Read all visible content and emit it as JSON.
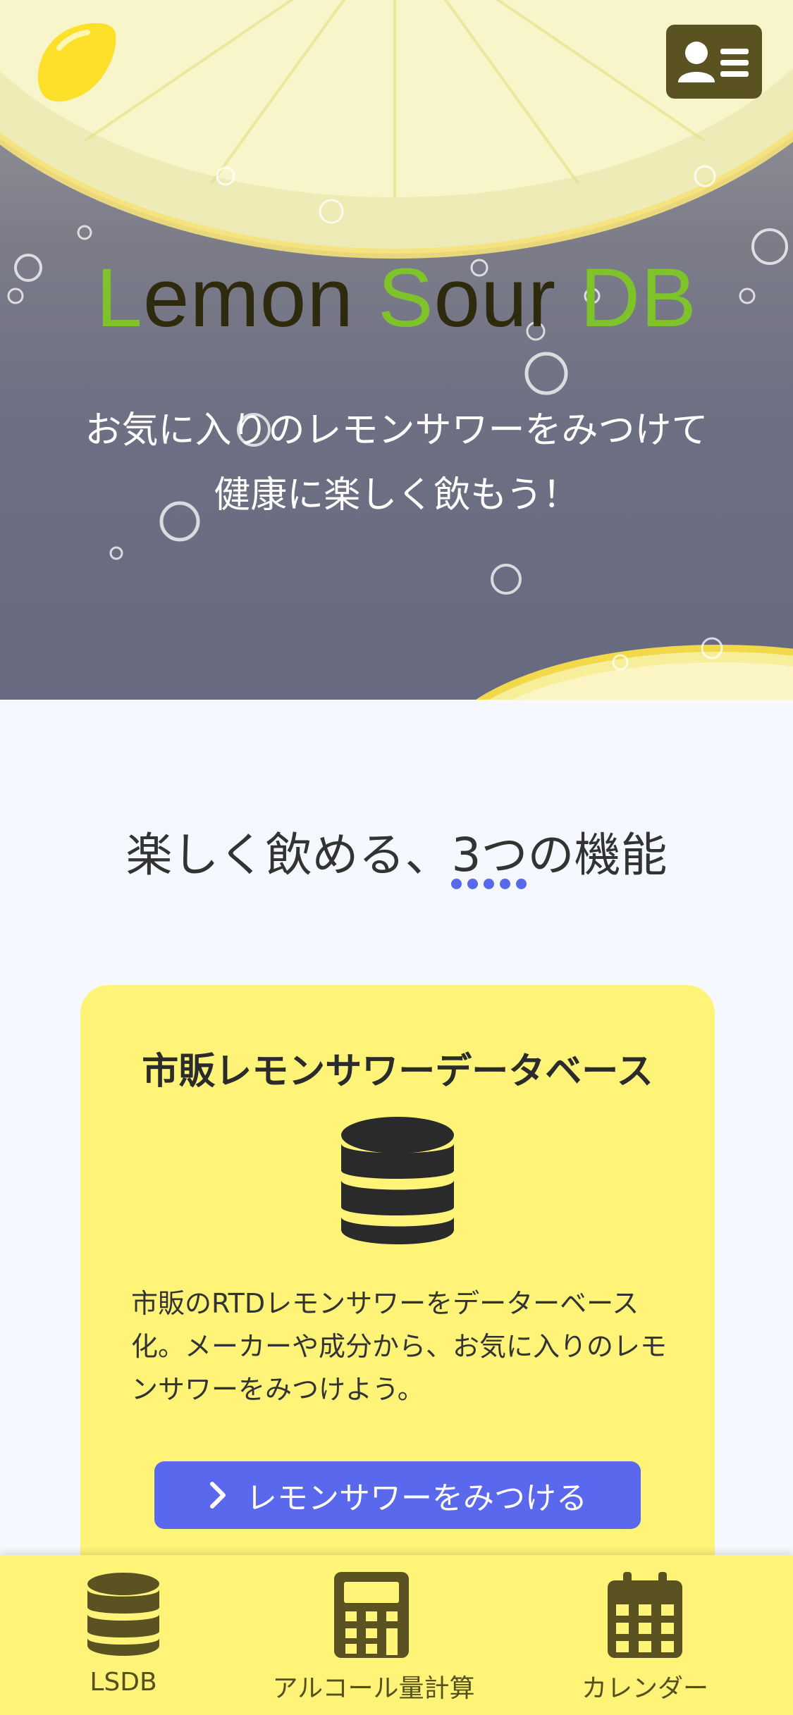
{
  "hero": {
    "title_parts": {
      "l": "L",
      "emon": "emon ",
      "s": "S",
      "our": "our ",
      "db": "DB"
    },
    "subtitle_line1": "お気に入りのレモンサワーをみつけて",
    "subtitle_line2": "健康に楽しく飲もう！",
    "logo_icon": "lemon-icon",
    "menu_icon": "user-menu-icon"
  },
  "features": {
    "title": "楽しく飲める、3つの機能",
    "accent_color": "#5a68ee"
  },
  "card": {
    "title": "市販レモンサワーデータベース",
    "icon": "database-icon",
    "description": "市販のRTDレモンサワーをデーターベース化。メーカーや成分から、お気に入りのレモンサワーをみつけよう。",
    "button_label": "レモンサワーをみつける",
    "background": "#fff478"
  },
  "bottom_nav": {
    "items": [
      {
        "label": "LSDB",
        "icon": "database-icon"
      },
      {
        "label": "アルコール量計算",
        "icon": "calculator-icon"
      },
      {
        "label": "カレンダー",
        "icon": "calendar-icon"
      }
    ]
  },
  "colors": {
    "brand_green": "#7fc32a",
    "lemon_yellow": "#fff478",
    "button_blue": "#5a68ee",
    "dark_olive": "#5a5220"
  }
}
